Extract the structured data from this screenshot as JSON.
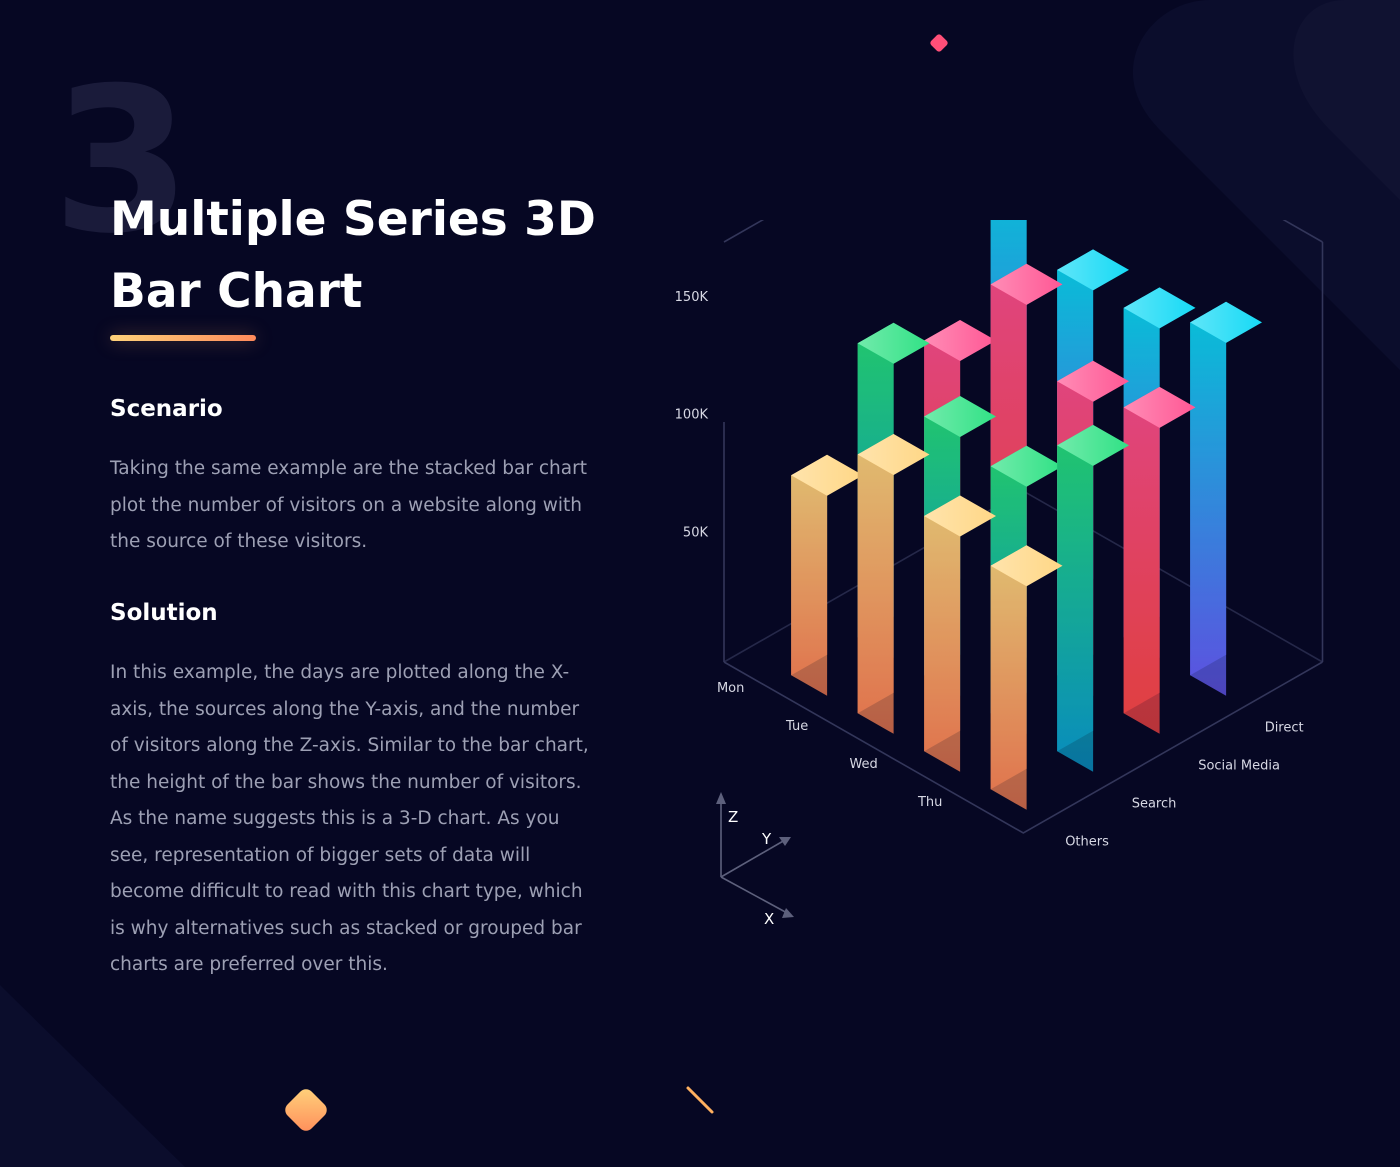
{
  "section_number": "3",
  "title": "Multiple Series 3D Bar Chart",
  "scenario": {
    "heading": "Scenario",
    "text": "Taking the same example are the stacked bar chart plot the number of visitors on a website along with the source of these visitors."
  },
  "solution": {
    "heading": "Solution",
    "text": "In this example, the days are plotted along the X-axis, the sources along the Y-axis, and the number of visitors along the Z-axis. Similar to the bar chart, the height of the bar shows the number of visitors. As the name suggests this is a 3-D chart. As you see, representation of bigger sets of data will become difficult to read with this chart type, which is why alternatives such as stacked or grouped bar charts are preferred over this."
  },
  "chart_data": {
    "type": "bar",
    "x_categories": [
      "Mon",
      "Tue",
      "Wed",
      "Thu"
    ],
    "y_categories": [
      "Others",
      "Search",
      "Social Media",
      "Direct"
    ],
    "z_ticks": [
      "50K",
      "100K",
      "150K"
    ],
    "z_tick_values": [
      50000,
      100000,
      150000
    ],
    "zlim": [
      0,
      170000
    ],
    "axis_letters": {
      "z": "Z",
      "y": "Y",
      "x": "X"
    },
    "series": [
      {
        "values": [
          85000,
          110000,
          100000,
          95000
        ],
        "color_top": "#ffd580",
        "color_bottom": "#ff8258"
      },
      {
        "values": [
          125000,
          110000,
          105000,
          130000
        ],
        "color_top": "#26e07f",
        "color_bottom": "#0aa0d8"
      },
      {
        "values": [
          110000,
          150000,
          125000,
          130000
        ],
        "color_top": "#ff4f8f",
        "color_bottom": "#ff4848"
      },
      {
        "values": [
          160000,
          140000,
          140000,
          150000
        ],
        "color_top": "#0ad8f5",
        "color_bottom": "#6a5cff"
      }
    ]
  }
}
